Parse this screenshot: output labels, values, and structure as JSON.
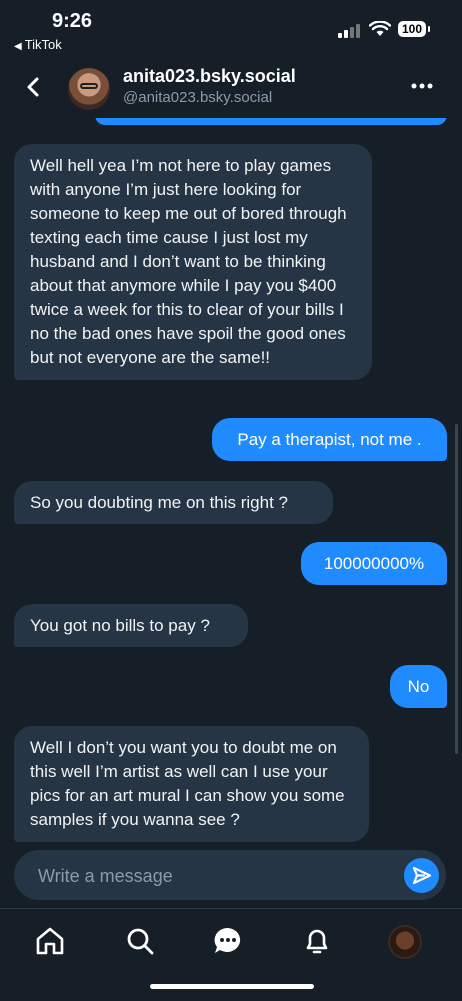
{
  "status_bar": {
    "time": "9:26",
    "back_app": "TikTok",
    "back_indicator": "◀",
    "battery": "100"
  },
  "header": {
    "display_name": "anita023.bsky.social",
    "handle": "@anita023.bsky.social"
  },
  "messages": [
    {
      "from": "them",
      "text": "Well hell yea I’m not here to play games with anyone I’m just here looking for someone to keep me out of bored through texting each time cause I just lost my husband and I don’t want to be thinking about that anymore while I pay you $400 twice a week for this to clear of your bills I no the bad ones have spoil the good ones but not everyone are the same!!"
    },
    {
      "from": "me",
      "text": "Pay a therapist, not me ."
    },
    {
      "from": "them",
      "text": "So you doubting me on this right ?"
    },
    {
      "from": "me",
      "text": "100000000%"
    },
    {
      "from": "them",
      "text": "You got no bills to pay ?"
    },
    {
      "from": "me",
      "text": "No"
    },
    {
      "from": "them",
      "text": "Well I don’t you want you to doubt me on this well I’m artist as well can I use your pics for an art mural I can show you some samples if you wanna see ?"
    }
  ],
  "composer": {
    "placeholder": "Write a message"
  },
  "colors": {
    "background": "#161E27",
    "incoming_bubble": "#263545",
    "outgoing_bubble": "#208BFE",
    "secondary_text": "#8C9BAB"
  },
  "tabs": [
    "home-icon",
    "search-icon",
    "chat-icon",
    "bell-icon",
    "profile-avatar"
  ]
}
